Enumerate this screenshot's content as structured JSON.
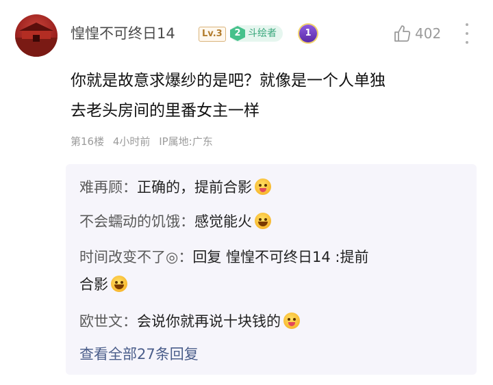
{
  "comment": {
    "username": "惶惶不可终日14",
    "level": "Lv.3",
    "badge_number": "2",
    "badge_label": "斗绘者",
    "medal_number": "1",
    "like_count": "402",
    "text_line1": "你就是故意求爆纱的是吧？就像是一个人单独",
    "text_line2": "去老头房间的里番女主一样",
    "floor": "第16楼",
    "time": "4小时前",
    "ip_location": "IP属地:广东"
  },
  "replies": [
    {
      "author": "难再顾：",
      "text": "正确的，提前合影",
      "emoji": "emoji-tongue"
    },
    {
      "author": "不会蠕动的饥饿：",
      "text": "感觉能火",
      "emoji": "emoji-grin"
    },
    {
      "author": "时间改变不了◎：",
      "text_line1": "回复 惶惶不可终日14 :提前",
      "text_line2": "合影",
      "emoji": "emoji-grin"
    },
    {
      "author": "欧世文：",
      "text": "会说你就再说十块钱的",
      "emoji": "emoji-tongue"
    }
  ],
  "view_all_replies": "查看全部27条回复",
  "colors": {
    "level_badge": "#b27c2d",
    "badge_green": "#46c18b",
    "link_blue": "#4a5d8a",
    "reply_bg": "#f6f5fb"
  }
}
